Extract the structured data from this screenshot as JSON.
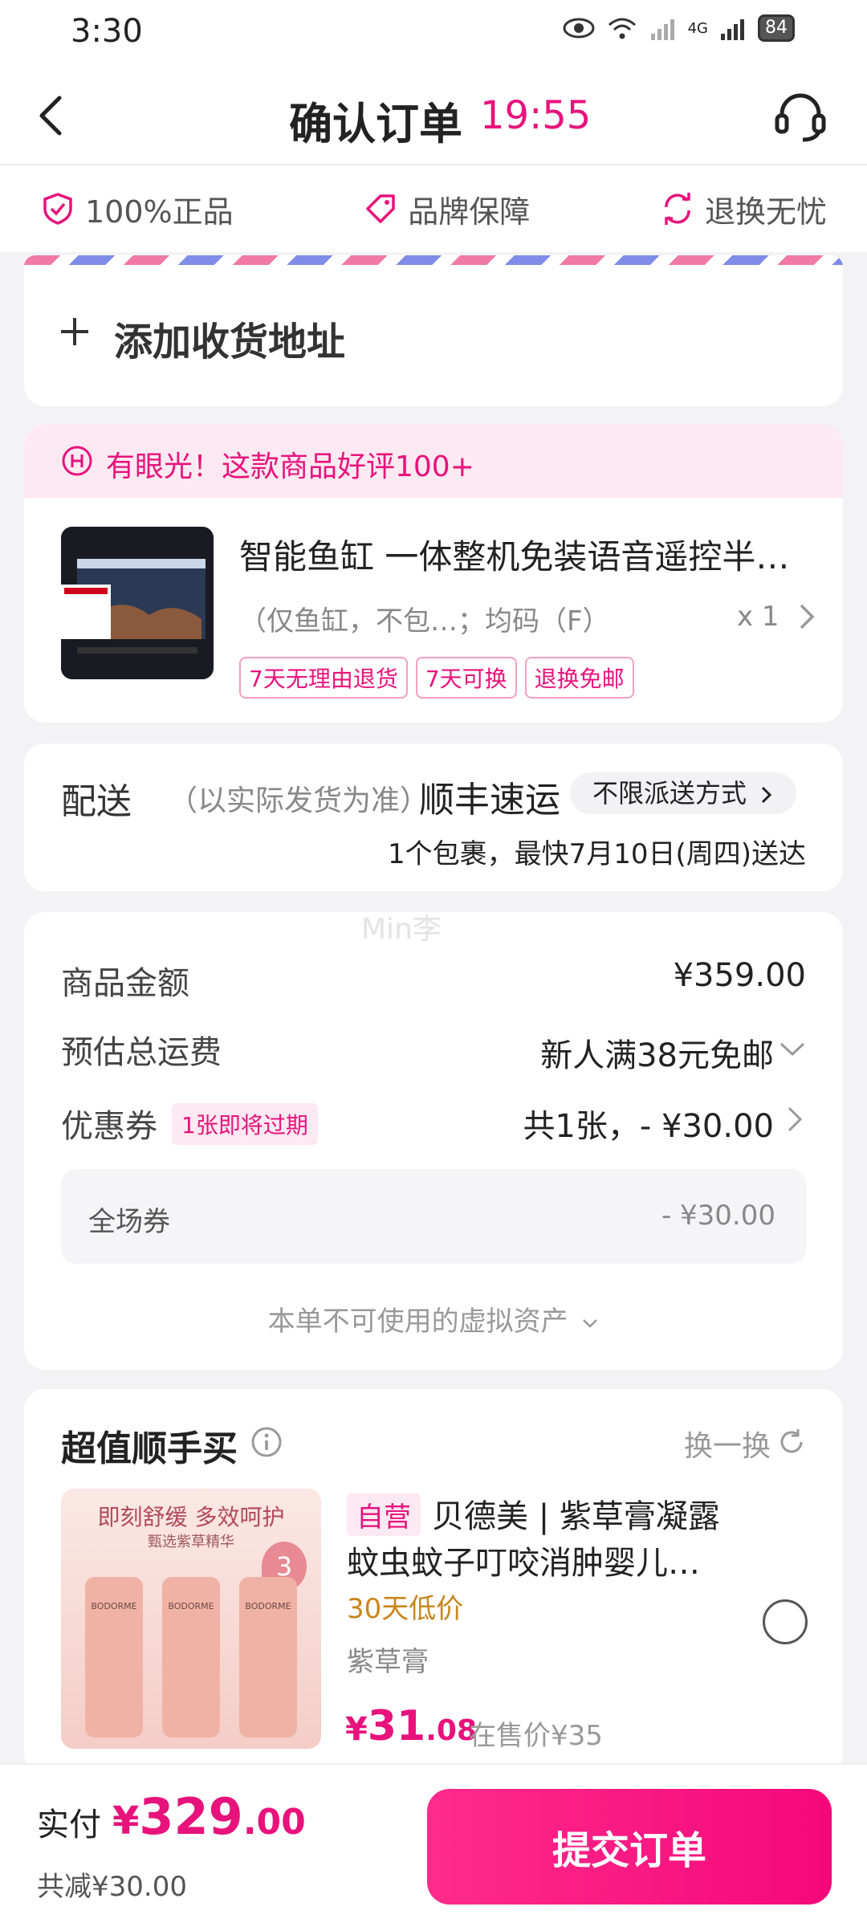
{
  "status_bar": {
    "time": "3:30",
    "network": "4G",
    "battery": "84"
  },
  "header": {
    "title": "确认订单",
    "countdown": "19:55"
  },
  "guarantees": [
    {
      "label": "100%正品",
      "icon": "shield-check-icon"
    },
    {
      "label": "品牌保障",
      "icon": "tag-icon"
    },
    {
      "label": "退换无忧",
      "icon": "exchange-icon"
    }
  ],
  "address": {
    "add_label": "添加收货地址"
  },
  "product": {
    "praise_text": "有眼光！这款商品好评100+",
    "title": "智能鱼缸 一体整机免装语音遥控半…",
    "spec": "（仅鱼缸，不包…；均码（F）",
    "quantity": "x 1",
    "tags": [
      "7天无理由退货",
      "7天可换",
      "退换免邮"
    ]
  },
  "delivery": {
    "label": "配送",
    "note": "（以实际发货为准）",
    "carrier": "顺丰速运",
    "method": "不限派送方式",
    "eta": "1个包裹，最快7月10日(周四)送达"
  },
  "pricing": {
    "watermark": "Min李",
    "goods_label": "商品金额",
    "goods_value": "¥359.00",
    "shipping_label": "预估总运费",
    "shipping_value": "新人满38元免邮",
    "coupon_label": "优惠券",
    "coupon_badge": "1张即将过期",
    "coupon_value": "共1张，- ¥30.00",
    "sub_coupon_label": "全场券",
    "sub_coupon_value": "- ¥30.00",
    "virtual_assets": "本单不可使用的虚拟资产"
  },
  "upsell": {
    "title": "超值顺手买",
    "refresh": "换一换",
    "self_tag": "自营",
    "name_line1": "贝德美 | 紫草膏凝露",
    "name_line2": "蚊虫蚊子叮咬消肿婴儿…",
    "low_price": "30天低价",
    "spec": "紫草膏",
    "price_yen": "¥",
    "price_int": "31",
    "price_dec": ".08",
    "orig_price": "在售价¥35",
    "image_text_top": "即刻舒缓 多效呵护",
    "image_text_sub": "甄选紫草精华",
    "image_brand": "BODORME",
    "image_badge": "3"
  },
  "bottom": {
    "pay_label": "实付",
    "pay_yen": "¥",
    "pay_int": "329",
    "pay_dec": ".00",
    "saved": "共减¥30.00",
    "submit": "提交订单"
  },
  "colors": {
    "accent": "#e8127c",
    "button": "#f5087a",
    "page_bg": "#f3f3f5"
  }
}
